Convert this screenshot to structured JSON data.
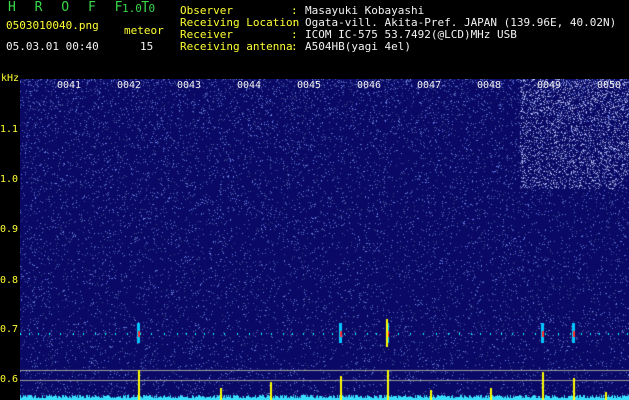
{
  "header": {
    "app_title": "H R O F F T",
    "app_version": "1.0.0",
    "file_name": "0503010040.png",
    "timestamp": "05.03.01 00:40",
    "meteor_label": "meteor",
    "meteor_count": "15"
  },
  "info": [
    {
      "label": "Observer",
      "value": "Masayuki Kobayashi"
    },
    {
      "label": "Receiving Location",
      "value": "Ogata-vill. Akita-Pref. JAPAN (139.96E, 40.02N)"
    },
    {
      "label": "Receiver",
      "value": "ICOM IC-575 53.7492(@LCD)MHz USB"
    },
    {
      "label": "Receiving antenna",
      "value": "A504HB(yagi 4el)"
    }
  ],
  "separator": ":",
  "spectrogram": {
    "frequency_unit": "kHz",
    "frequency_ticks": [
      "1.1",
      "1.0",
      "0.9",
      "0.8",
      "0.7",
      "0.6"
    ],
    "minute_labels": [
      "0041",
      "0042",
      "0043",
      "0044",
      "0045",
      "0046",
      "0047",
      "0048",
      "0049",
      "0050"
    ],
    "colors": {
      "background": "#0a0a66",
      "noise_dot": "#6f86ff",
      "count_trace": "#38e0ff",
      "meteor_spike": "#ffff00",
      "label_green": "#39d94a",
      "label_yellow": "#ffff33"
    }
  }
}
